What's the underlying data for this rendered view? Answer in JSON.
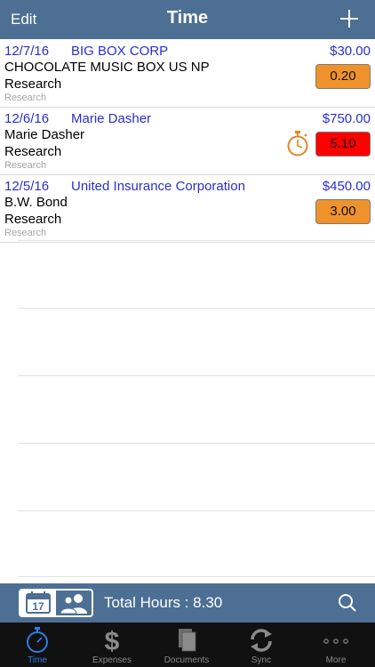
{
  "navbar": {
    "edit_label": "Edit",
    "title": "Time",
    "add_icon": "plus-icon"
  },
  "entries": [
    {
      "date": "12/7/16",
      "client": "BIG BOX CORP",
      "amount": "$30.00",
      "matter": "CHOCOLATE MUSIC BOX US NP",
      "activity": "Research",
      "sub": "Research",
      "hours": "0.20",
      "hours_color": "#f0922b",
      "timer": false
    },
    {
      "date": "12/6/16",
      "client": "Marie Dasher",
      "amount": "$750.00",
      "matter": "Marie Dasher",
      "activity": "Research",
      "sub": "Research",
      "hours": "5.10",
      "hours_color": "#ff0000",
      "timer": true
    },
    {
      "date": "12/5/16",
      "client": "United Insurance Corporation",
      "amount": "$450.00",
      "matter": "B.W. Bond",
      "activity": "Research",
      "sub": "Research",
      "hours": "3.00",
      "hours_color": "#f0922b",
      "timer": false
    }
  ],
  "infobar": {
    "calendar_day": "17",
    "total_hours": "Total Hours : 8.30"
  },
  "tabs": [
    {
      "label": "Time",
      "icon": "stopwatch-icon",
      "active": true
    },
    {
      "label": "Expenses",
      "icon": "dollar-icon",
      "active": false
    },
    {
      "label": "Documents",
      "icon": "documents-icon",
      "active": false
    },
    {
      "label": "Sync",
      "icon": "sync-icon",
      "active": false
    },
    {
      "label": "More",
      "icon": "more-icon",
      "active": false
    }
  ],
  "colors": {
    "bar": "#4d6f94",
    "link": "#2b2ed1",
    "tab_active": "#2f7de1"
  }
}
